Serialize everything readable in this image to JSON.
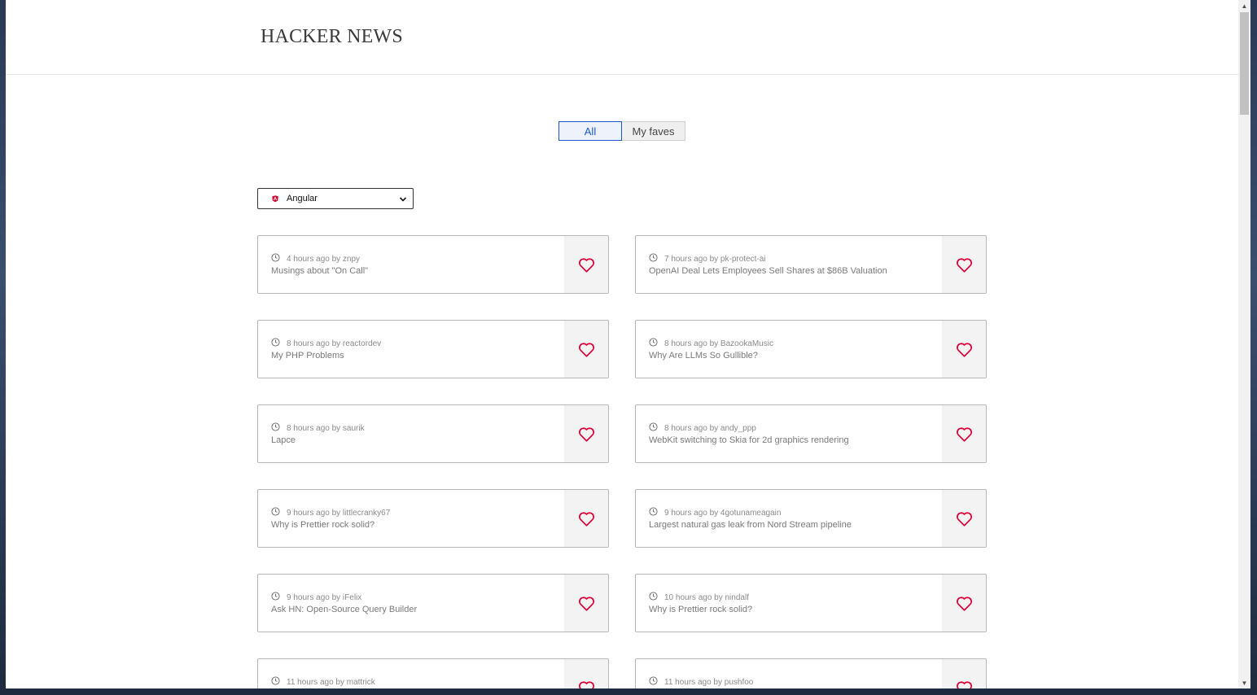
{
  "header": {
    "title": "HACKER NEWS"
  },
  "tabs": {
    "all_label": "All",
    "faves_label": "My faves"
  },
  "filter": {
    "selected": "Angular",
    "icon": "angular-icon"
  },
  "colors": {
    "accent": "#1b58d0",
    "heart": "#dd0031"
  },
  "stories": [
    {
      "time": "4 hours ago by znpy",
      "title": "Musings about \"On Call\""
    },
    {
      "time": "7 hours ago by pk-protect-ai",
      "title": "OpenAI Deal Lets Employees Sell Shares at $86B Valuation"
    },
    {
      "time": "8 hours ago by reactordev",
      "title": "My PHP Problems"
    },
    {
      "time": "8 hours ago by BazookaMusic",
      "title": "Why Are LLMs So Gullible?"
    },
    {
      "time": "8 hours ago by saurik",
      "title": "Lapce"
    },
    {
      "time": "8 hours ago by andy_ppp",
      "title": "WebKit switching to Skia for 2d graphics rendering"
    },
    {
      "time": "9 hours ago by littlecranky67",
      "title": "Why is Prettier rock solid?"
    },
    {
      "time": "9 hours ago by 4gotunameagain",
      "title": "Largest natural gas leak from Nord Stream pipeline"
    },
    {
      "time": "9 hours ago by iFelix",
      "title": "Ask HN: Open-Source Query Builder"
    },
    {
      "time": "10 hours ago by nindalf",
      "title": "Why is Prettier rock solid?"
    },
    {
      "time": "11 hours ago by mattrick",
      "title": ""
    },
    {
      "time": "11 hours ago by pushfoo",
      "title": ""
    }
  ]
}
